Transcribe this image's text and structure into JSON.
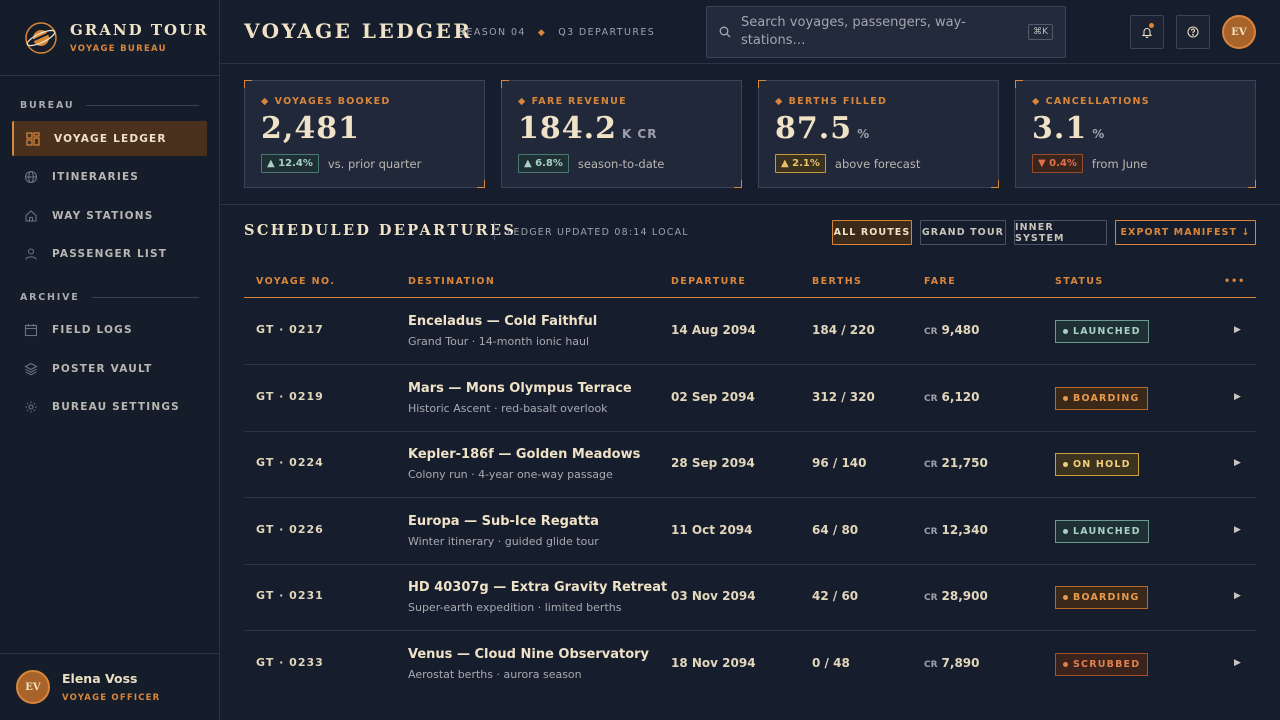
{
  "brand": {
    "title": "GRAND TOUR",
    "subtitle": "VOYAGE BUREAU"
  },
  "sidebar": {
    "sections": [
      {
        "label": "BUREAU",
        "items": [
          {
            "label": "VOYAGE LEDGER",
            "icon": "grid-icon",
            "active": true
          },
          {
            "label": "ITINERARIES",
            "icon": "globe-icon"
          },
          {
            "label": "WAY STATIONS",
            "icon": "home-icon"
          },
          {
            "label": "PASSENGER LIST",
            "icon": "user-icon"
          }
        ]
      },
      {
        "label": "ARCHIVE",
        "items": [
          {
            "label": "FIELD LOGS",
            "icon": "calendar-icon"
          },
          {
            "label": "POSTER VAULT",
            "icon": "layers-icon"
          },
          {
            "label": "BUREAU SETTINGS",
            "icon": "gear-icon"
          }
        ]
      }
    ]
  },
  "user": {
    "initials": "EV",
    "name": "Elena Voss",
    "role": "VOYAGE OFFICER"
  },
  "header": {
    "title": "VOYAGE LEDGER",
    "crumb1": "SEASON 04",
    "crumb2": "Q3 DEPARTURES",
    "search_placeholder": "Search voyages, passengers, way-stations…",
    "search_shortcut": "⌘K",
    "avatar_initials": "EV"
  },
  "stats": [
    {
      "label": "VOYAGES BOOKED",
      "value": "2,481",
      "unit": "",
      "delta": "▲ 12.4%",
      "delta_kind": "up",
      "note": "vs. prior quarter"
    },
    {
      "label": "FARE REVENUE",
      "value": "184.2",
      "unit": "K CR",
      "delta": "▲ 6.8%",
      "delta_kind": "up",
      "note": "season-to-date"
    },
    {
      "label": "BERTHS FILLED",
      "value": "87.5",
      "unit": "%",
      "delta": "▲ 2.1%",
      "delta_kind": "gold",
      "note": "above forecast"
    },
    {
      "label": "CANCELLATIONS",
      "value": "3.1",
      "unit": "%",
      "delta": "▼ 0.4%",
      "delta_kind": "down",
      "note": "from June"
    }
  ],
  "table": {
    "title": "SCHEDULED DEPARTURES",
    "updated": "LEDGER UPDATED 08:14 LOCAL",
    "filters": {
      "all": "ALL ROUTES",
      "grand": "GRAND TOUR",
      "inner": "INNER SYSTEM",
      "export": "EXPORT MANIFEST ↓"
    },
    "columns": {
      "vno": "VOYAGE NO.",
      "dest": "DESTINATION",
      "dep": "DEPARTURE",
      "berths": "BERTHS",
      "fare": "FARE",
      "status": "STATUS",
      "more": "•••"
    },
    "currency": "CR",
    "rows": [
      {
        "vno": "GT · 0217",
        "dest": "Enceladus — Cold Faithful",
        "sub": "Grand Tour · 14-month ionic haul",
        "dep": "14 Aug 2094",
        "berths": "184 / 220",
        "fare": "9,480",
        "status": "LAUNCHED",
        "kind": "launched"
      },
      {
        "vno": "GT · 0219",
        "dest": "Mars — Mons Olympus Terrace",
        "sub": "Historic Ascent · red-basalt overlook",
        "dep": "02 Sep 2094",
        "berths": "312 / 320",
        "fare": "6,120",
        "status": "BOARDING",
        "kind": "boarding"
      },
      {
        "vno": "GT · 0224",
        "dest": "Kepler-186f — Golden Meadows",
        "sub": "Colony run · 4-year one-way passage",
        "dep": "28 Sep 2094",
        "berths": "96 / 140",
        "fare": "21,750",
        "status": "ON HOLD",
        "kind": "onhold"
      },
      {
        "vno": "GT · 0226",
        "dest": "Europa — Sub-Ice Regatta",
        "sub": "Winter itinerary · guided glide tour",
        "dep": "11 Oct 2094",
        "berths": "64 / 80",
        "fare": "12,340",
        "status": "LAUNCHED",
        "kind": "launched"
      },
      {
        "vno": "GT · 0231",
        "dest": "HD 40307g — Extra Gravity Retreat",
        "sub": "Super-earth expedition · limited berths",
        "dep": "03 Nov 2094",
        "berths": "42 / 60",
        "fare": "28,900",
        "status": "BOARDING",
        "kind": "boarding"
      },
      {
        "vno": "GT · 0233",
        "dest": "Venus — Cloud Nine Observatory",
        "sub": "Aerostat berths · aurora season",
        "dep": "18 Nov 2094",
        "berths": "0 / 48",
        "fare": "7,890",
        "status": "SCRUBBED",
        "kind": "scrubbed"
      }
    ]
  }
}
